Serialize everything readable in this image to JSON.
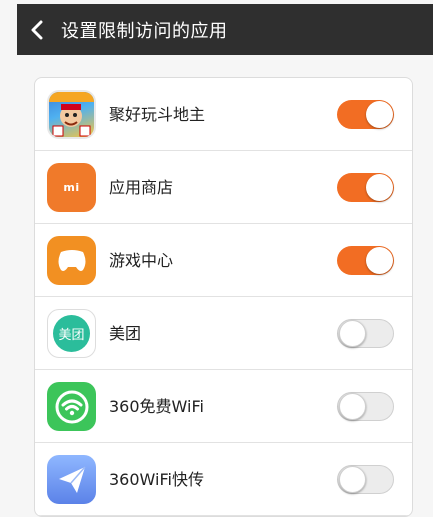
{
  "header": {
    "title": "设置限制访问的应用",
    "back_icon": "chevron-left-icon"
  },
  "apps": [
    {
      "name": "聚好玩斗地主",
      "icon": "poker-game-icon",
      "icon_text": "",
      "enabled": true
    },
    {
      "name": "应用商店",
      "icon": "mi-store-icon",
      "icon_text": "mi",
      "enabled": true
    },
    {
      "name": "游戏中心",
      "icon": "gamepad-icon",
      "icon_text": "",
      "enabled": true
    },
    {
      "name": "美团",
      "icon": "meituan-icon",
      "icon_text": "美团",
      "enabled": false
    },
    {
      "name": "360免费WiFi",
      "icon": "wifi-icon",
      "icon_text": "",
      "enabled": false
    },
    {
      "name": "360WiFi快传",
      "icon": "paper-plane-icon",
      "icon_text": "",
      "enabled": false
    }
  ],
  "colors": {
    "header_bg": "#2f2f2f",
    "toggle_on": "#f26d23",
    "toggle_off": "#ececec"
  }
}
